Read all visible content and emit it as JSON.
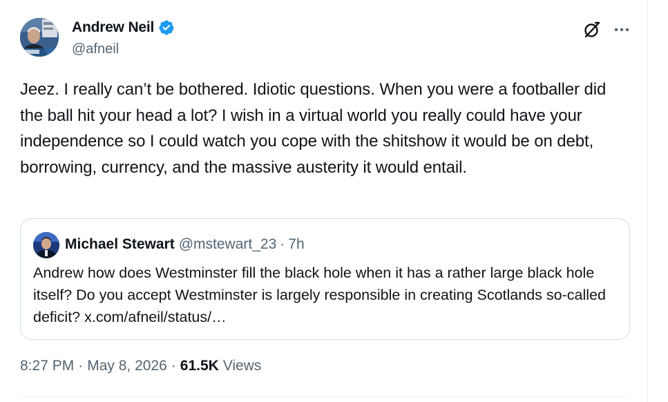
{
  "author": {
    "display_name": "Andrew Neil",
    "handle": "@afneil",
    "verified": true,
    "avatar_icon": "avatar-photo"
  },
  "actions": {
    "grok_icon": "grok-icon",
    "more_icon": "more-dots-icon"
  },
  "tweet": {
    "text": "Jeez. I really can’t be bothered. Idiotic questions. When you were a footballer did the ball hit your head a lot? I wish in a virtual world you really could have your independence so I could watch you cope with the shitshow it would be on debt, borrowing, currency, and the massive austerity it would entail."
  },
  "quoted": {
    "display_name": "Michael Stewart",
    "handle": "@mstewart_23",
    "separator": "·",
    "time": "7h",
    "text": "Andrew how does Westminster fill the black hole when it has a rather large black hole itself? Do you accept Westminster is largely responsible in creating Scotlands so-called deficit? x.com/afneil/status/…"
  },
  "meta": {
    "time": "8:27 PM",
    "separator": "·",
    "date": "May 8, 2026",
    "views_count": "61.5K",
    "views_label": "Views"
  },
  "colors": {
    "text_primary": "#0f1419",
    "text_secondary": "#536471",
    "verified_blue": "#1d9bf0",
    "border": "#cfd9de"
  }
}
